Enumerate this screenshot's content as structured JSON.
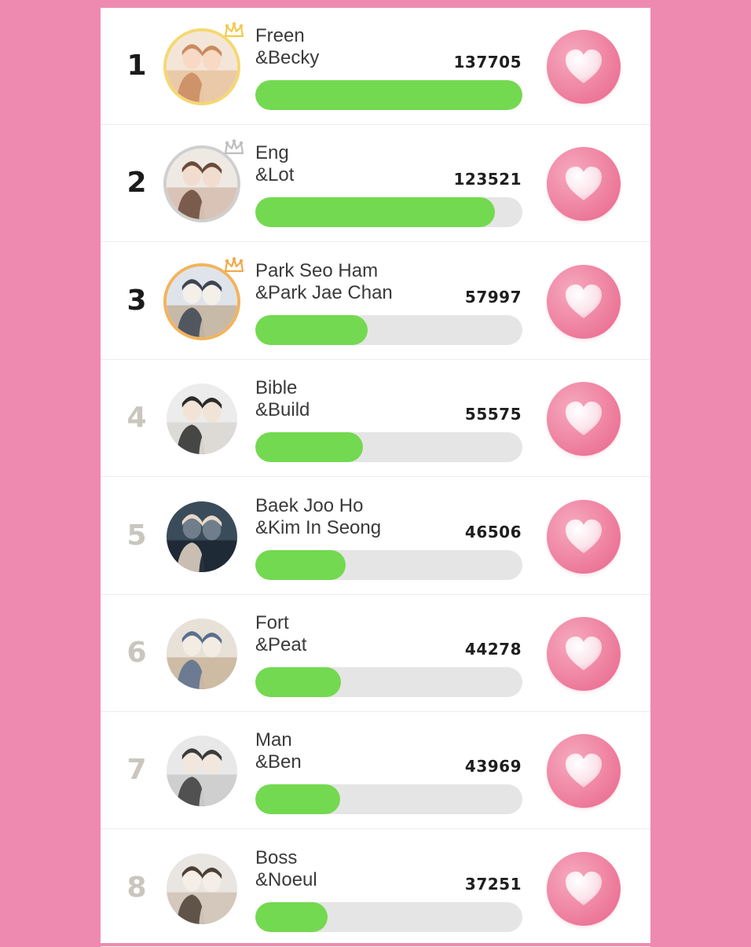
{
  "colors": {
    "page_background": "#ee8aaf",
    "bar_fill": "#73d950",
    "bar_track": "#e5e5e5",
    "heart_button": "#ee7f9f",
    "medal_gold": "#f6d772",
    "medal_silver": "#cfcfcf",
    "medal_bronze": "#f2b35c"
  },
  "ranking": [
    {
      "rank": "1",
      "line1": "Freen",
      "line2": "&Becky",
      "votes": "137705",
      "bar_fraction": 1.0,
      "medal": "gold",
      "icon": "heart-icon"
    },
    {
      "rank": "2",
      "line1": "Eng",
      "line2": "&Lot",
      "votes": "123521",
      "bar_fraction": 0.897,
      "medal": "silver",
      "icon": "heart-icon"
    },
    {
      "rank": "3",
      "line1": "Park Seo Ham",
      "line2": "&Park Jae Chan",
      "votes": "57997",
      "bar_fraction": 0.421,
      "medal": "bronze",
      "icon": "heart-icon"
    },
    {
      "rank": "4",
      "line1": "Bible",
      "line2": "&Build",
      "votes": "55575",
      "bar_fraction": 0.404,
      "medal": "none",
      "icon": "heart-icon"
    },
    {
      "rank": "5",
      "line1": "Baek Joo Ho",
      "line2": "&Kim In Seong",
      "votes": "46506",
      "bar_fraction": 0.338,
      "medal": "none",
      "icon": "heart-icon"
    },
    {
      "rank": "6",
      "line1": "Fort",
      "line2": "&Peat",
      "votes": "44278",
      "bar_fraction": 0.322,
      "medal": "none",
      "icon": "heart-icon"
    },
    {
      "rank": "7",
      "line1": "Man",
      "line2": "&Ben",
      "votes": "43969",
      "bar_fraction": 0.319,
      "medal": "none",
      "icon": "heart-icon"
    },
    {
      "rank": "8",
      "line1": "Boss",
      "line2": "&Noeul",
      "votes": "37251",
      "bar_fraction": 0.271,
      "medal": "none",
      "icon": "heart-icon"
    }
  ]
}
